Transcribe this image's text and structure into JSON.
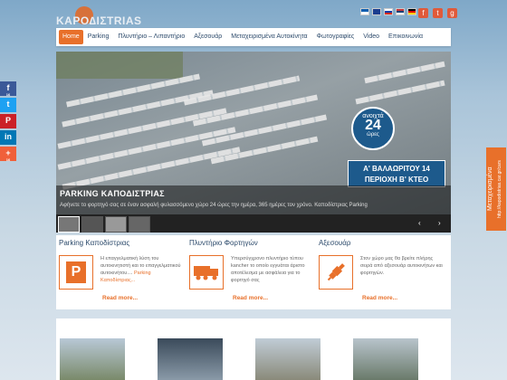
{
  "logo": {
    "text": "KAPO∆ΙΣTRIAS"
  },
  "header": {
    "flags": [
      "#ffffff",
      "#0d5eaf",
      "#d52b1e",
      "#ffffff",
      "#c8102e"
    ],
    "socials": [
      "f",
      "t",
      "g"
    ]
  },
  "nav": {
    "items": [
      "Home",
      "Parking",
      "Πλυντήριο – Λιπαντήριο",
      "Αξεσουάρ",
      "Μεταχειρισμένα Αυτοκίνητα",
      "Φωτογραφίες",
      "Video",
      "Επικοινωνία"
    ]
  },
  "slider": {
    "badge": {
      "line1": "ανοιχτά",
      "line2": "24",
      "line3": "ώρες"
    },
    "address": {
      "line1": "Α' ΒΑΛΑΩΡΙΤΟΥ 14",
      "line2": "ΠΕΡΙΟΧΗ Β' ΚΤΕΟ"
    },
    "caption_title": "PARKING ΚΑΠΟΔΙΣΤΡΙΑΣ",
    "caption_text": "Αφήνετε το φορτηγό σας σε έναν ασφαλή φυλασσόμενο χώρο 24 ώρες την ημέρα, 365 ημέρες τον χρόνο. Καποδίστριας Parking"
  },
  "share": {
    "buttons": [
      {
        "icon": "f",
        "count": "16"
      },
      {
        "icon": "t",
        "count": ""
      },
      {
        "icon": "P",
        "count": ""
      },
      {
        "icon": "in",
        "count": ""
      },
      {
        "icon": "+",
        "count": "16"
      }
    ]
  },
  "used_tab": {
    "line1": "Μεταχειρισμένα",
    "line2": "http://kapodistrias.car.gr/cars"
  },
  "features": [
    {
      "title": "Parking Καποδίστριας",
      "text": "Η επαγγελματική λύση του αυτοκινητιστή και το επαγγελματικού αυτοκινήτου....",
      "highlight": "Parking Καποδίστριας...",
      "more": "Read more..."
    },
    {
      "title": "Πλυντήριο Φορτηγών",
      "text": "Υπερσύγχρονο πλυντήριο τύπου kancher το οποίο εγγυάται άριστο αποτέλεσμα με ασφάλεια για το φορτηγό σας",
      "highlight": "",
      "more": "Read more..."
    },
    {
      "title": "Αξεσουάρ",
      "text": "Στον χώρο μας θα βρείτε πλήρης σειρά από αξεσουάρ αυτοκινήτων και φορτηγών.",
      "highlight": "",
      "more": "Read more..."
    }
  ]
}
